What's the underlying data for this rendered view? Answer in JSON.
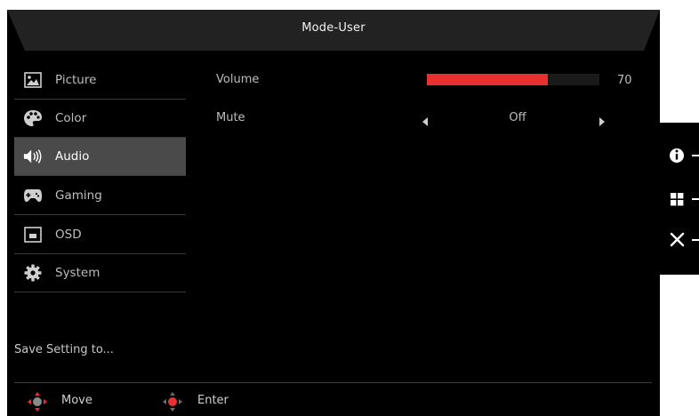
{
  "header": {
    "title": "Mode-User"
  },
  "sidebar": {
    "items": [
      {
        "label": "Picture",
        "icon": "picture-icon"
      },
      {
        "label": "Color",
        "icon": "palette-icon"
      },
      {
        "label": "Audio",
        "icon": "speaker-icon",
        "active": true
      },
      {
        "label": "Gaming",
        "icon": "gamepad-icon"
      },
      {
        "label": "OSD",
        "icon": "osd-icon"
      },
      {
        "label": "System",
        "icon": "gear-icon"
      }
    ],
    "save_setting": "Save Setting to..."
  },
  "main": {
    "volume": {
      "label": "Volume",
      "value": "70",
      "fraction": 0.7
    },
    "mute": {
      "label": "Mute",
      "value": "Off"
    }
  },
  "footer": {
    "move_label": "Move",
    "enter_label": "Enter"
  },
  "hotkeys": [
    {
      "icon": "info-icon"
    },
    {
      "icon": "menu-grid-icon"
    },
    {
      "icon": "close-icon"
    }
  ],
  "colors": {
    "accent": "#e8302e",
    "panel_bg": "#000000",
    "active_bg": "#4a4a4a"
  }
}
